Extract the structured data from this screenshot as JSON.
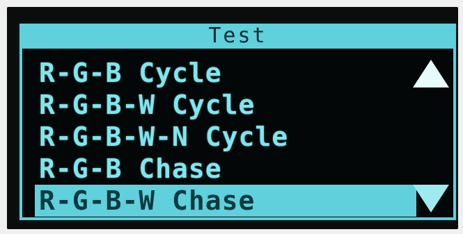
{
  "header": {
    "title": "Test"
  },
  "menu": {
    "items": [
      {
        "label": "R-G-B Cycle",
        "selected": false
      },
      {
        "label": "R-G-B-W Cycle",
        "selected": false
      },
      {
        "label": "R-G-B-W-N Cycle",
        "selected": false
      },
      {
        "label": "R-G-B Chase",
        "selected": false
      },
      {
        "label": "R-G-B-W Chase",
        "selected": true
      }
    ]
  },
  "scrollbar": {
    "up_icon": "triangle-up-icon",
    "down_icon": "triangle-down-icon"
  },
  "colors": {
    "accent": "#5fd0dc",
    "text": "#7fe6ef",
    "screen_bg": "#040707",
    "selected_text": "#0b3a40"
  }
}
